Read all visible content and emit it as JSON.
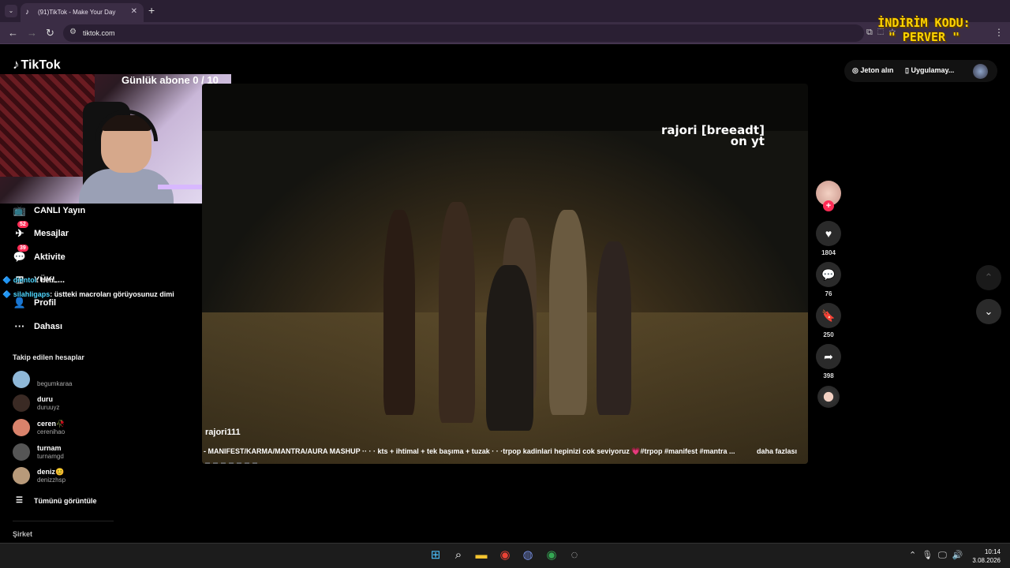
{
  "browser": {
    "tab_title": "(91)TikTok - Make Your Day",
    "url": "tiktok.com",
    "tab_favicon": "♪",
    "close_icon": "✕",
    "new_tab_icon": "+"
  },
  "promo": {
    "line1": "İNDİRİM KODU:",
    "line2": "\" PERVER \""
  },
  "tiktok": {
    "logo": "TikTok",
    "daily_sub_goal": "Günlük abone 0 / 10",
    "header": {
      "coins_label": "Jeton alın",
      "app_label": "Uygulamay..."
    },
    "nav": [
      {
        "label": "CANLI Yayın",
        "icon": "live-icon",
        "glyph": "📺"
      },
      {
        "label": "Mesajlar",
        "icon": "messages-icon",
        "glyph": "✈",
        "badge": "52"
      },
      {
        "label": "Aktivite",
        "icon": "activity-icon",
        "glyph": "💬",
        "badge": "39"
      },
      {
        "label": "YÜKL...",
        "icon": "upload-icon",
        "glyph": "⊞"
      },
      {
        "label": "Profil",
        "icon": "profile-icon",
        "glyph": "👤"
      },
      {
        "label": "Dahası",
        "icon": "more-icon",
        "glyph": "···"
      }
    ],
    "following_title": "Takip edilen hesaplar",
    "following": [
      {
        "name": "",
        "username": "begumkaraa",
        "color": "#8fb8d8"
      },
      {
        "name": "duru",
        "username": "duruuyz",
        "color": "#3a2a24"
      },
      {
        "name": "ceren🥀",
        "username": "cerenihao",
        "color": "#d9826b"
      },
      {
        "name": "turnam",
        "username": "turnamgd",
        "color": "#555"
      },
      {
        "name": "deniz😊",
        "username": "denizzhsp",
        "color": "#b89a7a"
      }
    ],
    "see_all": "Tümünü görüntüle",
    "company": "Şirket"
  },
  "chat": [
    {
      "user": "dientoi",
      "message": ": heh"
    },
    {
      "user": "silahligaps",
      "message": ": üstteki macroları görüyosunuz dimi"
    }
  ],
  "video": {
    "watermark_line1": "rajori [breeadt]",
    "watermark_line2": "on yt",
    "author": "rajori111",
    "caption": "- MANIFEST/KARMA/MANTRA/AURA MASHUP ·· · · kts + ihtimal + tek başıma + tuzak · · ·trpop kadinlari hepinizi cok seviyoruz 💗#trpop #manifest #mantra ...",
    "more": "daha fazlası",
    "likes": "1804",
    "comments": "76",
    "saves": "250",
    "shares": "398"
  },
  "taskbar": {
    "time": "10:14",
    "date": "3.08.2026"
  }
}
